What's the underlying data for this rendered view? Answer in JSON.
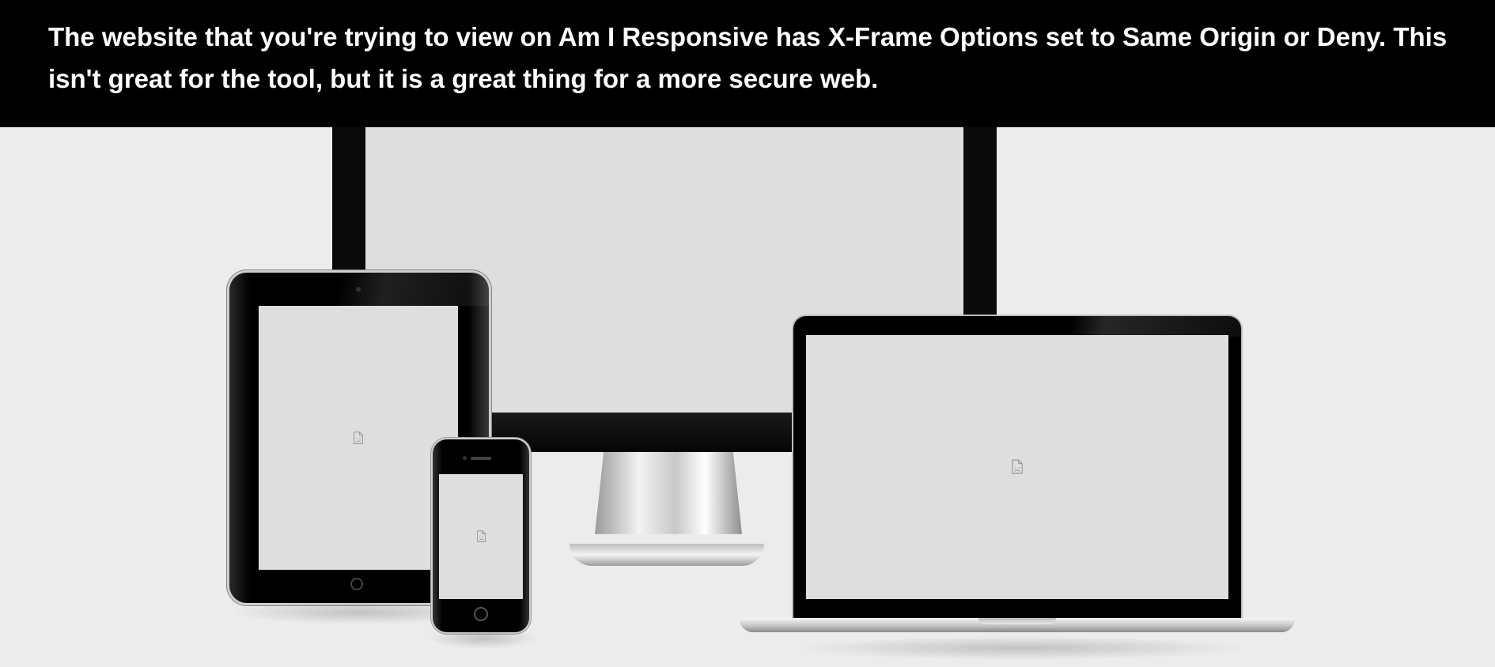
{
  "banner": {
    "message": "The website that you're trying to view on Am I Responsive has X-Frame Options set to Same Origin or Deny. This isn't great for the tool, but it is a great thing for a more secure web."
  },
  "devices": {
    "desktop": {
      "screen_icon": "broken-image-icon"
    },
    "tablet": {
      "screen_icon": "broken-image-icon"
    },
    "phone": {
      "screen_icon": "broken-image-icon"
    },
    "laptop": {
      "screen_icon": "broken-image-icon"
    }
  },
  "colors": {
    "banner_bg": "#000000",
    "banner_text": "#ffffff",
    "page_bg": "#ececec",
    "screen_bg": "#dedede"
  }
}
